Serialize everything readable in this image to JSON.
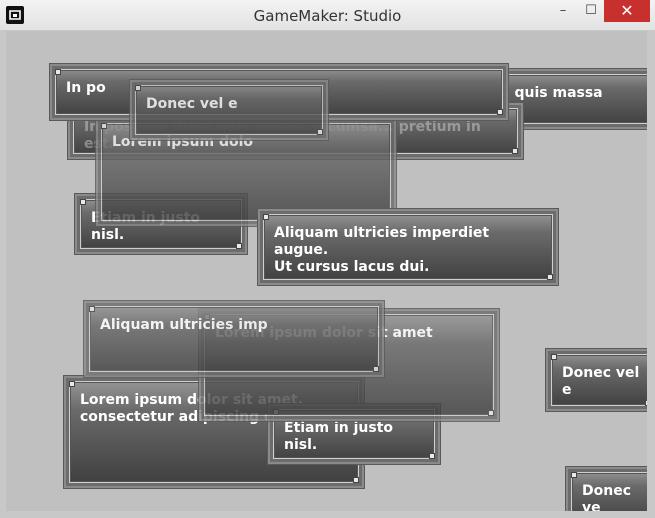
{
  "window": {
    "title": "GameMaker: Studio",
    "minimize_label": "–",
    "maximize_label": "☐",
    "close_label": "✕"
  },
  "textboxes": [
    {
      "text": "In po"
    },
    {
      "text": "Donec vel e"
    },
    {
      "text": "In posuere diam quis massa accum"
    },
    {
      "text": "In posuere diam quis massa accumsa...   pretium in est."
    },
    {
      "text": "Lorem ipsum dolo"
    },
    {
      "text": "Etiam in justo nisl."
    },
    {
      "text": "Aliquam ultricies imperdiet augue.\nUt cursus lacus dui."
    },
    {
      "text": "Aliquam ultricies imp"
    },
    {
      "text": "Lorem ipsum dolor sit amet"
    },
    {
      "text": "Lorem ipsum dolor sit amet,\nconsectetur adipiscing elit."
    },
    {
      "text": "Etiam in justo nisl."
    },
    {
      "text": "Donec vel e"
    },
    {
      "text": "Donec ve"
    }
  ]
}
